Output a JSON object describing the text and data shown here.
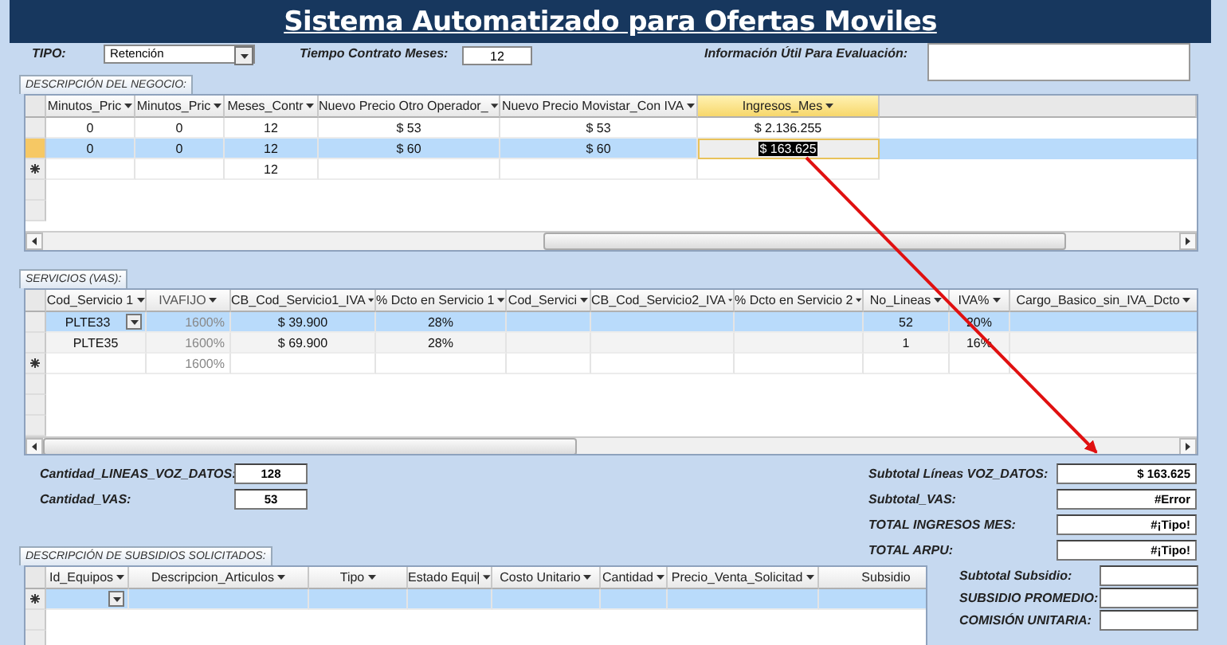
{
  "window": {
    "title": "Sistema Automatizado para Ofertas Moviles"
  },
  "filters": {
    "tipo": {
      "label": "TIPO:",
      "value": "Retención"
    },
    "contract": {
      "label": "Tiempo Contrato Meses:",
      "value": "12"
    },
    "info": {
      "label": "Información Útil Para Evaluación:"
    }
  },
  "business": {
    "tab": "DESCRIPCIÓN DEL NEGOCIO:",
    "columns": [
      {
        "label": "Minutos_Pric",
        "dropdown": true,
        "selected": false
      },
      {
        "label": "Minutos_Pric",
        "dropdown": true,
        "selected": false
      },
      {
        "label": "Meses_Contr",
        "dropdown": true,
        "selected": false
      },
      {
        "label": "Nuevo Precio Otro Operador_",
        "dropdown": true,
        "selected": false
      },
      {
        "label": "Nuevo Precio Movistar_Con IVA",
        "dropdown": true,
        "selected": false
      },
      {
        "label": "Ingresos_Mes",
        "dropdown": true,
        "selected": true
      }
    ],
    "rows": [
      {
        "selected": false,
        "new": false,
        "cells": [
          {
            "text": "0",
            "selected": false
          },
          {
            "text": "0",
            "selected": false
          },
          {
            "text": "12",
            "selected": false
          },
          {
            "text": "$ 53",
            "selected": false
          },
          {
            "text": "$ 53",
            "selected": false
          },
          {
            "text": "$ 2.136.255",
            "selected": false
          }
        ]
      },
      {
        "selected": true,
        "new": false,
        "cells": [
          {
            "text": "0",
            "selected": false
          },
          {
            "text": "0",
            "selected": false
          },
          {
            "text": "12",
            "selected": false
          },
          {
            "text": "$ 60",
            "selected": false
          },
          {
            "text": "$ 60",
            "selected": false
          },
          {
            "text": "$ 163.625",
            "selected": true
          }
        ]
      },
      {
        "selected": false,
        "new": true,
        "cells": [
          {
            "text": null,
            "selected": false
          },
          {
            "text": null,
            "selected": false
          },
          {
            "text": "12",
            "selected": false
          },
          {
            "text": null,
            "selected": false
          },
          {
            "text": null,
            "selected": false
          },
          {
            "text": null,
            "selected": false
          }
        ]
      }
    ]
  },
  "services": {
    "tab": "SERVICIOS (VAS):",
    "columns": [
      {
        "label": "Cod_Servicio 1",
        "dropdown": true,
        "disabled": false
      },
      {
        "label": "IVAFIJO",
        "dropdown": true,
        "disabled": true
      },
      {
        "label": "CB_Cod_Servicio1_IVA",
        "dropdown": true,
        "disabled": false
      },
      {
        "label": "% Dcto en Servicio 1",
        "dropdown": true,
        "disabled": false
      },
      {
        "label": "Cod_Servici",
        "dropdown": true,
        "disabled": false
      },
      {
        "label": "CB_Cod_Servicio2_IVA",
        "dropdown": true,
        "disabled": false
      },
      {
        "label": "% Dcto en Servicio 2",
        "dropdown": true,
        "disabled": false
      },
      {
        "label": "No_Lineas",
        "dropdown": true,
        "disabled": false
      },
      {
        "label": "IVA%",
        "dropdown": true,
        "disabled": false
      },
      {
        "label": "Cargo_Basico_sin_IVA_Dcto",
        "dropdown": true,
        "disabled": false
      }
    ],
    "rows": [
      {
        "selected": true,
        "new": false,
        "cells": [
          {
            "text": "PLTE33",
            "combo": true
          },
          "1600%",
          "$ 39.900",
          "28%",
          null,
          null,
          null,
          "52",
          "20%",
          null
        ]
      },
      {
        "selected": false,
        "new": false,
        "cells": [
          "PLTE35",
          "1600%",
          "$ 69.900",
          "28%",
          null,
          null,
          null,
          "1",
          "16%",
          null
        ]
      },
      {
        "selected": false,
        "new": true,
        "cells": [
          null,
          "1600%",
          null,
          null,
          null,
          null,
          null,
          null,
          null,
          null
        ]
      }
    ]
  },
  "counts": [
    {
      "label": "Cantidad_LINEAS_VOZ_DATOS:",
      "value": "128"
    },
    {
      "label": "Cantidad_VAS:",
      "value": "53"
    }
  ],
  "totals": [
    {
      "label": "Subtotal Líneas VOZ_DATOS:",
      "value": "$ 163.625"
    },
    {
      "label": "Subtotal_VAS:",
      "value": "#Error"
    },
    {
      "label": "TOTAL INGRESOS MES:",
      "value": "#¡Tipo!"
    },
    {
      "label": "TOTAL ARPU:",
      "value": "#¡Tipo!"
    }
  ],
  "subsidies": {
    "tab": "DESCRIPCIÓN DE SUBSIDIOS SOLICITADOS:",
    "columns": [
      {
        "label": "Id_Equipos",
        "dropdown": true
      },
      {
        "label": "Descripcion_Articulos",
        "dropdown": true
      },
      {
        "label": "Tipo",
        "dropdown": true
      },
      {
        "label": "Estado Equi|",
        "dropdown": true
      },
      {
        "label": "Costo Unitario",
        "dropdown": true
      },
      {
        "label": "Cantidad",
        "dropdown": true
      },
      {
        "label": "Precio_Venta_Solicitad",
        "dropdown": true
      },
      {
        "label": "Subsidio",
        "dropdown": false
      }
    ],
    "rows": [
      {
        "selected": true,
        "new": true,
        "cells": [
          {
            "text": null,
            "combo": true
          },
          null,
          null,
          null,
          null,
          null,
          null,
          null
        ]
      }
    ]
  },
  "subsidy_totals": [
    {
      "label": "Subtotal Subsidio:"
    },
    {
      "label": "SUBSIDIO PROMEDIO:"
    },
    {
      "label": "COMISIÓN UNITARIA:"
    }
  ]
}
